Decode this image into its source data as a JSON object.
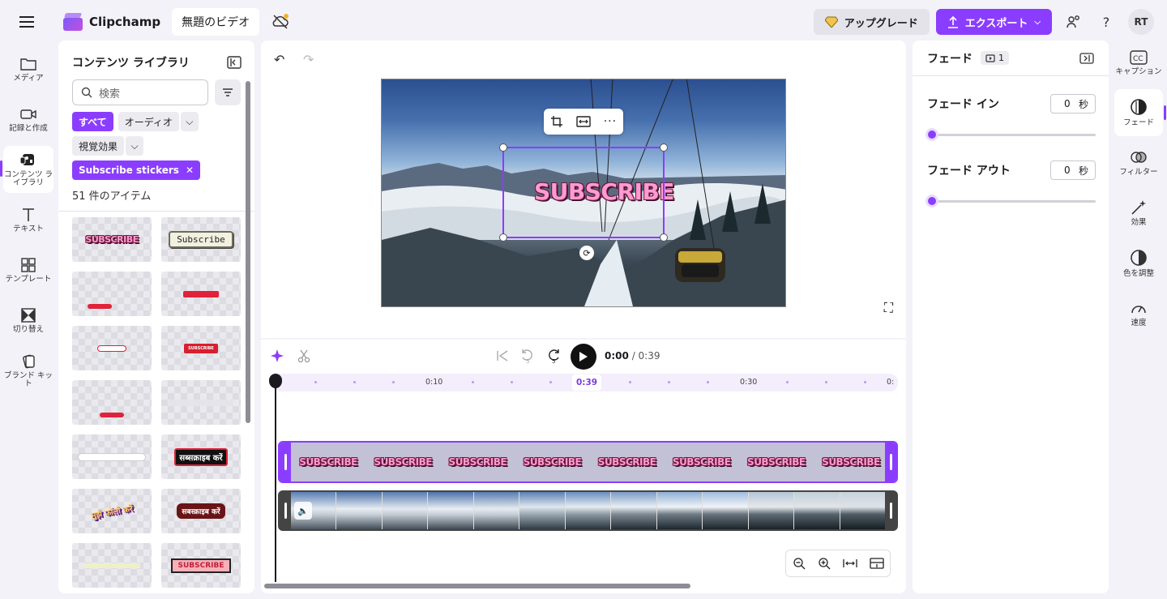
{
  "app": {
    "name": "Clipchamp",
    "project_title": "無題のビデオ",
    "upgrade_label": "アップグレード",
    "export_label": "エクスポート",
    "avatar_initials": "RT",
    "help_label": "?"
  },
  "leftnav": {
    "items": [
      {
        "label": "メディア",
        "icon": "folder-icon"
      },
      {
        "label": "記録と作成",
        "icon": "camera-icon"
      },
      {
        "label": "コンテンツ ライブラリ",
        "icon": "content-library-icon",
        "active": true
      },
      {
        "label": "テキスト",
        "icon": "text-icon"
      },
      {
        "label": "テンプレート",
        "icon": "templates-icon"
      },
      {
        "label": "切り替え",
        "icon": "transitions-icon"
      },
      {
        "label": "ブランド キット",
        "icon": "brand-kit-icon"
      }
    ]
  },
  "library": {
    "title": "コンテンツ ライブラリ",
    "search_placeholder": "検索",
    "chips": {
      "all": "すべて",
      "audio": "オーディオ",
      "visual_effects": "視覚効果",
      "active_filter": "Subscribe stickers"
    },
    "item_count": "51 件のアイテム",
    "thumbs": {
      "t2": "Subscribe",
      "t5": "SUBSCRIBE",
      "t10": "सब्सक्राइब करें",
      "t11": "मुझे फॉलो करें",
      "t12": "सबस्क्राइब करें",
      "t14": "SUBSCRIBE"
    }
  },
  "stage": {
    "sticker_text": "SUBSCRIBE"
  },
  "timeline": {
    "current_time": "0:00",
    "total_time": "/ 0:39",
    "playhead_pill": "0:39",
    "ticks": [
      "0:10",
      "0:30",
      "0:"
    ],
    "sticker_label": "SUBSCRIBE"
  },
  "props": {
    "title": "フェード",
    "clip_count": "1",
    "fade_in_label": "フェード イン",
    "fade_in_value": "0",
    "fade_out_label": "フェード アウト",
    "fade_out_value": "0",
    "unit": "秒"
  },
  "rightrail": {
    "items": [
      {
        "label": "キャプション",
        "icon": "captions-icon"
      },
      {
        "label": "フェード",
        "icon": "fade-icon",
        "active": true
      },
      {
        "label": "フィルター",
        "icon": "filters-icon"
      },
      {
        "label": "効果",
        "icon": "effects-icon"
      },
      {
        "label": "色を調整",
        "icon": "color-adjust-icon"
      },
      {
        "label": "速度",
        "icon": "speed-icon"
      }
    ]
  },
  "colors": {
    "accent": "#8b3dff",
    "background": "#f3f2f8",
    "panel": "#ffffff"
  }
}
